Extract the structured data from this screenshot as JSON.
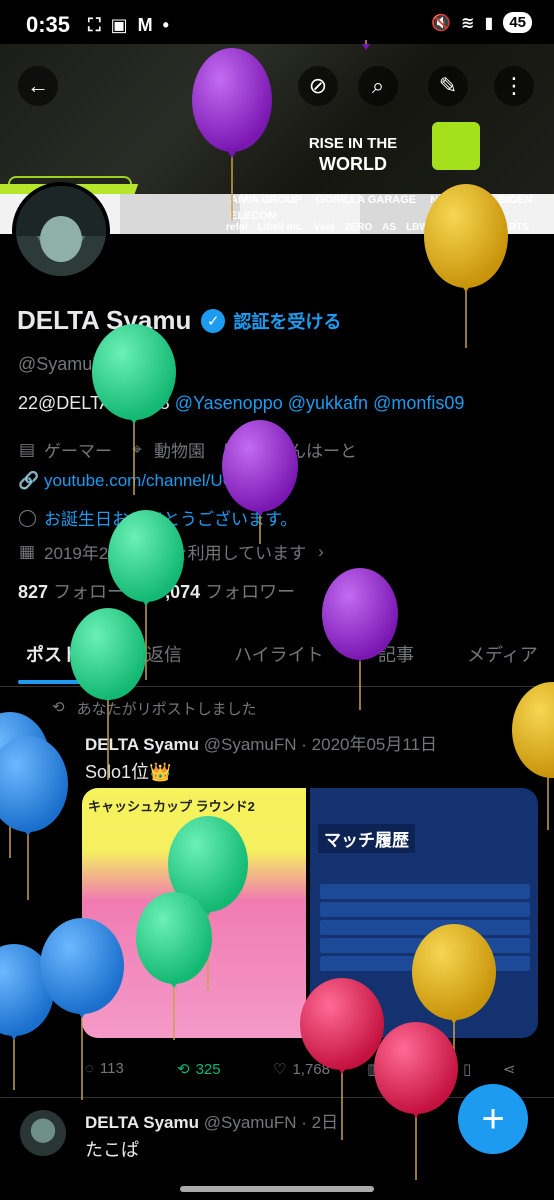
{
  "status_bar": {
    "time": "0:35",
    "battery": "45"
  },
  "profile": {
    "name": "DELTA Syamu",
    "get_verified": "認証を受ける",
    "handle": "@SyamuFN",
    "bio_prefix": "22@DELTAGG058",
    "bio_mentions": [
      "@Yasenoppo",
      "@yukkafn",
      "@monfis09"
    ],
    "category": "ゲーマー",
    "location": "動物園",
    "location_extra": "りょっくんはーと",
    "website": "youtube.com/channel/UC7uWE...",
    "birthday": "お誕生日おめでとうございます。",
    "joined": "2019年2月からXを利用しています",
    "following_count": "827",
    "following_label": "フォロー",
    "followers_count": "10,074",
    "followers_label": "フォロワー"
  },
  "banner": {
    "line1": "RISE IN THE",
    "line2": "WORLD",
    "sponsors_row1": [
      "AIWA GROUP",
      "GORILLA GARAGE",
      "NEXTMAP",
      "BIDEN",
      "ELECOM"
    ],
    "sponsors_row2": [
      "refol",
      "Libell Inc.",
      "Vaid",
      "ZERO",
      "AS",
      "LBWK",
      "DIGITAL HEARTS"
    ]
  },
  "tabs": [
    "ポスト",
    "返信",
    "ハイライト",
    "記事",
    "メディア"
  ],
  "feed": [
    {
      "repost_label": "あなたがリポストしました",
      "name": "DELTA Syamu",
      "handle_date": "@SyamuFN · 2020年05月11日",
      "text": "Solo1位👑",
      "media1_title": "キャッシュカップ ラウンド2",
      "media2_title": "マッチ履歴",
      "replies": "113",
      "reposts": "325",
      "likes": "1,768"
    },
    {
      "name": "DELTA Syamu",
      "handle_date": "@SyamuFN · 2日",
      "text": "たこぱ"
    }
  ],
  "colors": {
    "accent": "#1d9bf0",
    "repost_green": "#00ba7c",
    "balloon_purple": "#9b2fd0",
    "balloon_yellow": "#e7b512",
    "balloon_green": "#24d58e",
    "balloon_blue": "#2d8fe6",
    "balloon_red": "#e3245d"
  }
}
